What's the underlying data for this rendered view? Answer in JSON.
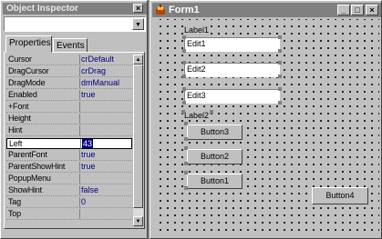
{
  "inspector": {
    "title": "Object Inspector",
    "close_glyph": "×",
    "selected_component": "",
    "tabs": [
      {
        "label": "Properties",
        "active": true
      },
      {
        "label": "Events",
        "active": false
      }
    ],
    "properties": [
      {
        "name": "Cursor",
        "value": "crDefault"
      },
      {
        "name": "DragCursor",
        "value": "crDrag"
      },
      {
        "name": "DragMode",
        "value": "dmManual"
      },
      {
        "name": "Enabled",
        "value": "true"
      },
      {
        "name": "+Font",
        "value": ""
      },
      {
        "name": "Height",
        "value": ""
      },
      {
        "name": "Hint",
        "value": ""
      },
      {
        "name": "Left",
        "value": "43",
        "selected": true
      },
      {
        "name": "ParentFont",
        "value": "true"
      },
      {
        "name": "ParentShowHint",
        "value": "true"
      },
      {
        "name": "PopupMenu",
        "value": ""
      },
      {
        "name": "ShowHint",
        "value": "false"
      },
      {
        "name": "Tag",
        "value": "0"
      },
      {
        "name": "Top",
        "value": ""
      }
    ]
  },
  "form": {
    "title": "Form1",
    "window_buttons": {
      "minimize": "_",
      "maximize": "□",
      "close": "×"
    },
    "label1": "Label1",
    "label2": "Label2",
    "edits": [
      "Edit1",
      "Edit2",
      "Edit3"
    ],
    "buttons": [
      "Button3",
      "Button2",
      "Button1",
      "Button4"
    ]
  }
}
